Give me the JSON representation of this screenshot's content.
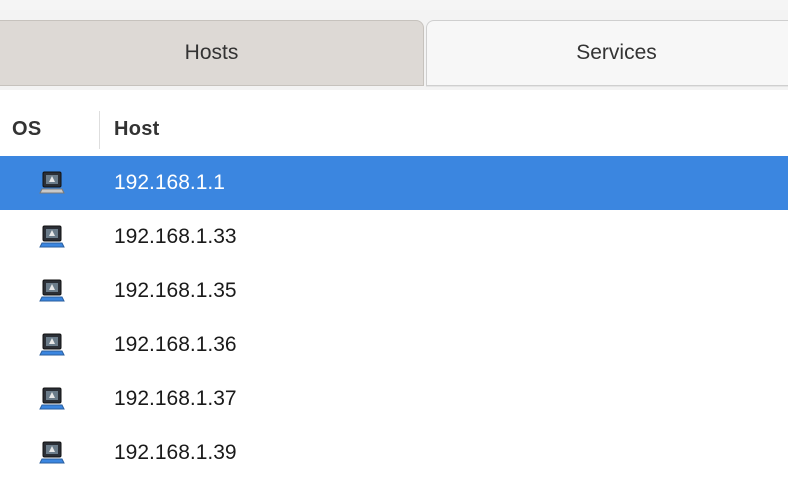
{
  "tabs": [
    {
      "label": "Hosts",
      "active": true
    },
    {
      "label": "Services",
      "active": false
    }
  ],
  "table": {
    "columns": {
      "os": "OS",
      "host": "Host"
    },
    "rows": [
      {
        "host": "192.168.1.1",
        "os_icon": "os-unknown-icon",
        "selected": true
      },
      {
        "host": "192.168.1.33",
        "os_icon": "os-unknown-icon",
        "selected": false
      },
      {
        "host": "192.168.1.35",
        "os_icon": "os-unknown-icon",
        "selected": false
      },
      {
        "host": "192.168.1.36",
        "os_icon": "os-unknown-icon",
        "selected": false
      },
      {
        "host": "192.168.1.37",
        "os_icon": "os-unknown-icon",
        "selected": false
      },
      {
        "host": "192.168.1.39",
        "os_icon": "os-unknown-icon",
        "selected": false
      }
    ]
  },
  "colors": {
    "selection": "#3b86e0",
    "active_tab": "#ddd9d5",
    "inactive_tab": "#f7f7f7"
  }
}
